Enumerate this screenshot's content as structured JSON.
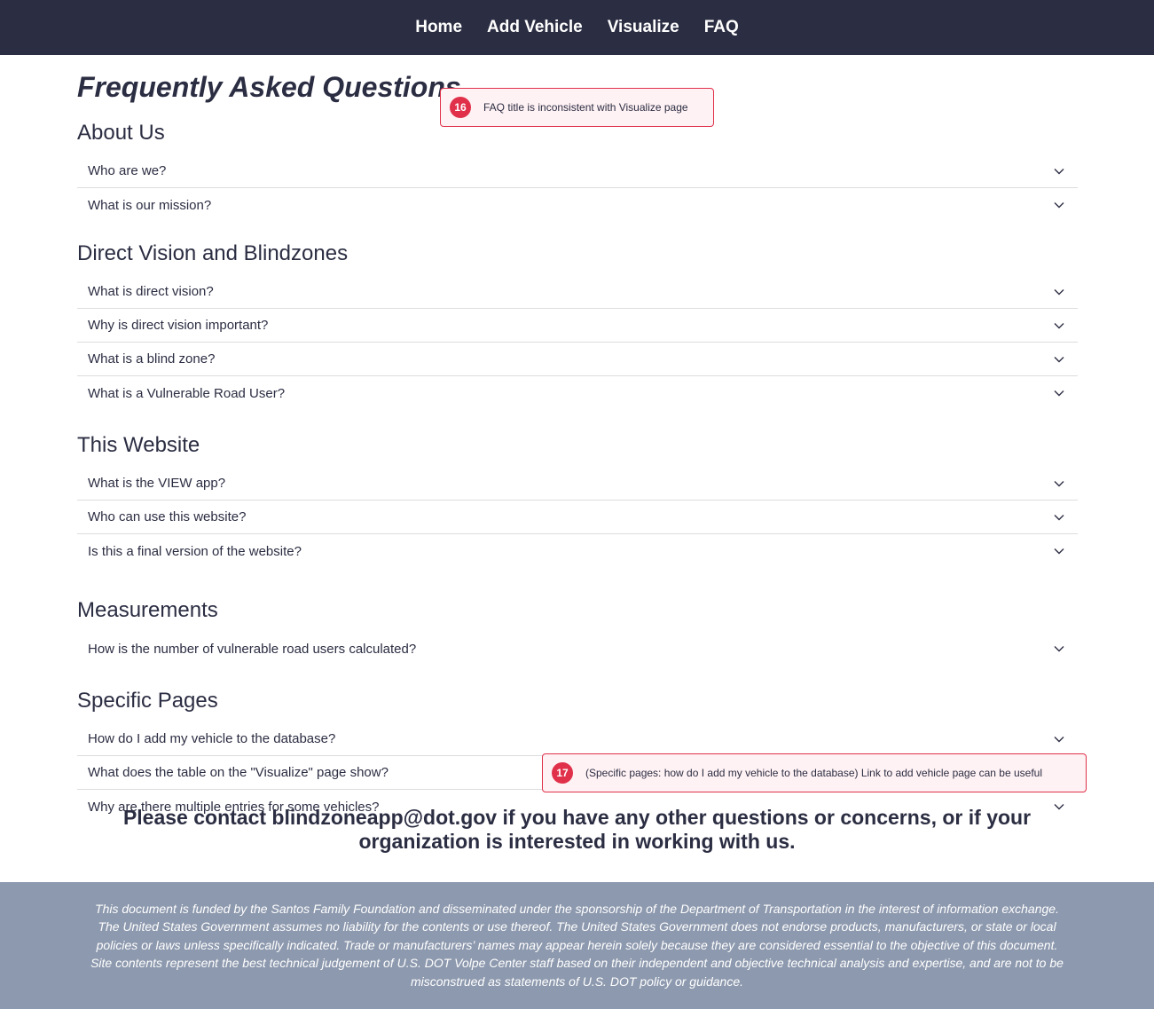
{
  "nav": {
    "items": [
      "Home",
      "Add Vehicle",
      "Visualize",
      "FAQ"
    ]
  },
  "page_title": "Frequently Asked Questions",
  "sections": [
    {
      "title": "About Us",
      "questions": [
        "Who are we?",
        "What is our mission?"
      ]
    },
    {
      "title": "Direct Vision and Blindzones",
      "questions": [
        "What is direct vision?",
        "Why is direct vision important?",
        "What is a blind zone?",
        "What is a Vulnerable Road User?"
      ]
    },
    {
      "title": "This Website",
      "questions": [
        "What is the VIEW app?",
        "Who can use this website?",
        "Is this a final version of the website?"
      ]
    },
    {
      "title": "Measurements",
      "questions": [
        "How is the number of vulnerable road users calculated?"
      ]
    },
    {
      "title": "Specific Pages",
      "questions": [
        "How do I add my vehicle to the database?",
        "What does the table on the \"Visualize\" page show?",
        "Why are there multiple entries for some vehicles?"
      ]
    }
  ],
  "contact_text": "Please contact blindzoneapp@dot.gov if you have any other questions or concerns, or if your organization is interested in working with us.",
  "footer_text": "This document is funded by the Santos Family Foundation and disseminated under the sponsorship of the Department of Transportation in the interest of information exchange. The United States Government assumes no liability for the contents or use thereof. The United States Government does not endorse products, manufacturers, or state or local policies or laws unless specifically indicated. Trade or manufacturers’ names may appear herein solely because they are considered essential to the objective of this document. Site contents represent the best technical judgement of U.S. DOT Volpe Center staff based on their independent and objective technical analysis and expertise, and are not to be misconstrued as statements of U.S. DOT policy or guidance.",
  "annotations": [
    {
      "number": "16",
      "text": "FAQ title is inconsistent with Visualize page"
    },
    {
      "number": "17",
      "text": "(Specific pages: how do I add my vehicle to the database) Link to add vehicle page can be useful"
    }
  ],
  "colors": {
    "navbar": "#2b2d42",
    "footer": "#8d99ae",
    "annotation_accent": "#e0304a"
  },
  "icons": {
    "accordion": "chevron-down-icon"
  }
}
